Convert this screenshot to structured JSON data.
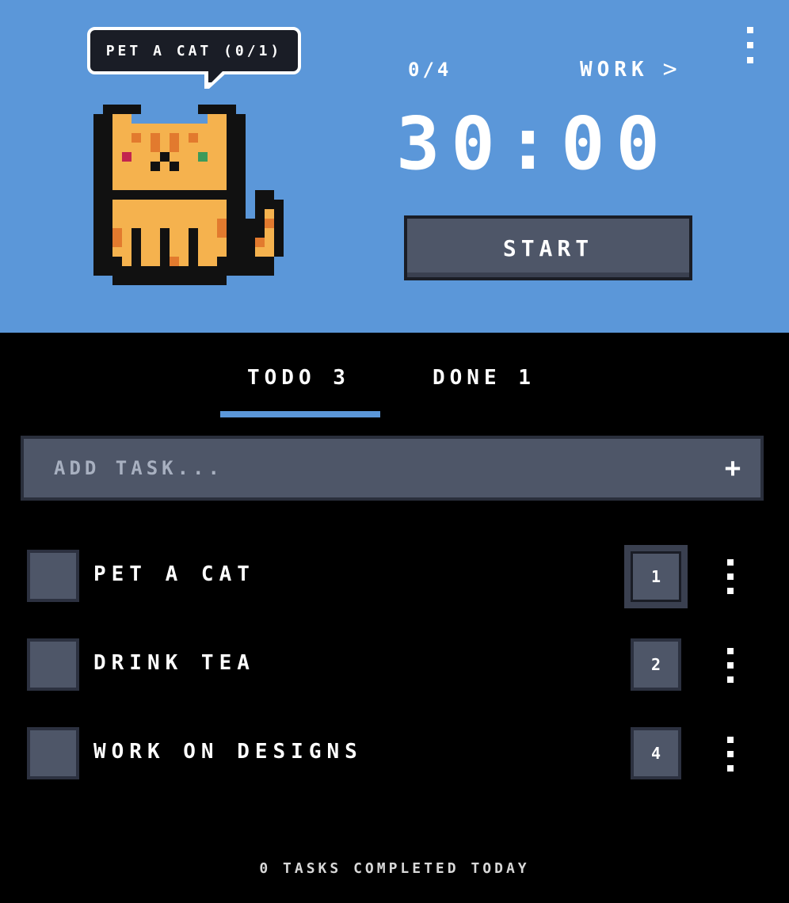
{
  "header": {
    "speech_bubble": "PET A CAT (0/1)",
    "session_counter": "0/4",
    "mode_label": "WORK",
    "mode_next_icon": "chevron-right-icon",
    "menu_icon": "kebab-menu-icon",
    "timer": "30:00",
    "start_label": "START",
    "background_color": "#5b97d9",
    "mascot": "cat-icon"
  },
  "tabs": [
    {
      "label": "TODO 3",
      "active": true
    },
    {
      "label": "DONE 1",
      "active": false
    }
  ],
  "add_task": {
    "placeholder": "ADD TASK...",
    "add_icon": "plus-icon"
  },
  "tasks": [
    {
      "title": "PET A CAT",
      "count": "1",
      "checked": false
    },
    {
      "title": "DRINK TEA",
      "count": "2",
      "checked": false
    },
    {
      "title": "WORK ON DESIGNS",
      "count": "4",
      "checked": false
    }
  ],
  "footer": {
    "summary": "0 TASKS COMPLETED TODAY"
  }
}
